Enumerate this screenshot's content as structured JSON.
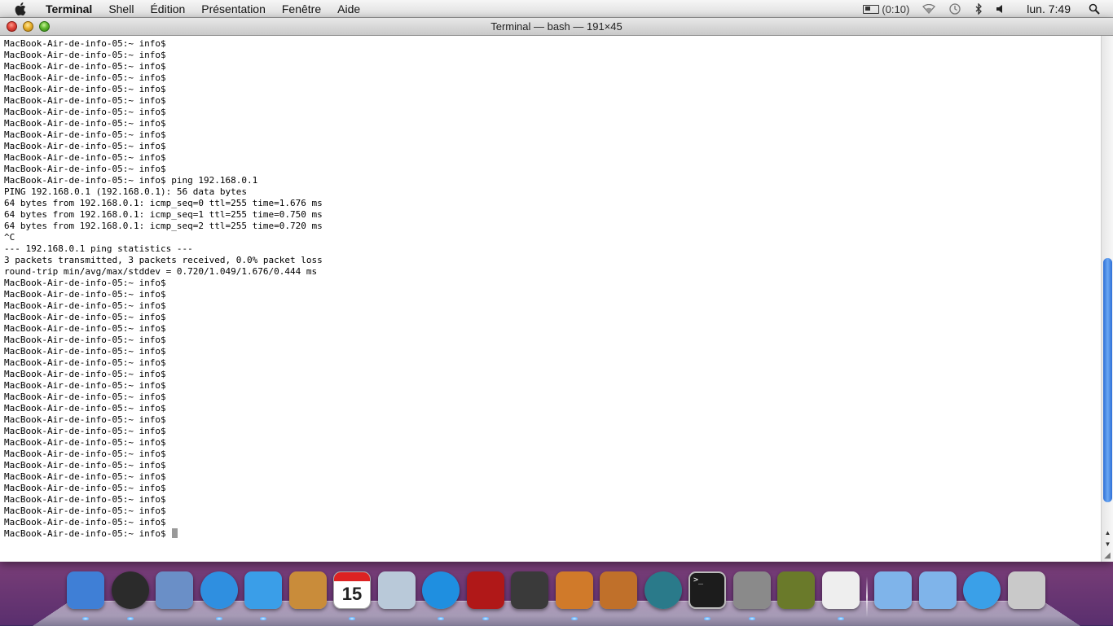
{
  "menubar": {
    "app_name": "Terminal",
    "items": [
      "Shell",
      "Édition",
      "Présentation",
      "Fenêtre",
      "Aide"
    ],
    "status": {
      "battery": "(0:10)",
      "clock": "lun. 7:49"
    }
  },
  "window": {
    "title": "Terminal — bash — 191×45"
  },
  "terminal": {
    "lines": [
      "MacBook-Air-de-info-05:~ info$",
      "MacBook-Air-de-info-05:~ info$",
      "MacBook-Air-de-info-05:~ info$",
      "MacBook-Air-de-info-05:~ info$",
      "MacBook-Air-de-info-05:~ info$",
      "MacBook-Air-de-info-05:~ info$",
      "MacBook-Air-de-info-05:~ info$",
      "MacBook-Air-de-info-05:~ info$",
      "MacBook-Air-de-info-05:~ info$",
      "MacBook-Air-de-info-05:~ info$",
      "MacBook-Air-de-info-05:~ info$",
      "MacBook-Air-de-info-05:~ info$",
      "MacBook-Air-de-info-05:~ info$ ping 192.168.0.1",
      "PING 192.168.0.1 (192.168.0.1): 56 data bytes",
      "64 bytes from 192.168.0.1: icmp_seq=0 ttl=255 time=1.676 ms",
      "64 bytes from 192.168.0.1: icmp_seq=1 ttl=255 time=0.750 ms",
      "64 bytes from 192.168.0.1: icmp_seq=2 ttl=255 time=0.720 ms",
      "^C",
      "--- 192.168.0.1 ping statistics ---",
      "3 packets transmitted, 3 packets received, 0.0% packet loss",
      "round-trip min/avg/max/stddev = 0.720/1.049/1.676/0.444 ms",
      "MacBook-Air-de-info-05:~ info$",
      "MacBook-Air-de-info-05:~ info$",
      "MacBook-Air-de-info-05:~ info$",
      "MacBook-Air-de-info-05:~ info$",
      "MacBook-Air-de-info-05:~ info$",
      "MacBook-Air-de-info-05:~ info$",
      "MacBook-Air-de-info-05:~ info$",
      "MacBook-Air-de-info-05:~ info$",
      "MacBook-Air-de-info-05:~ info$",
      "MacBook-Air-de-info-05:~ info$",
      "MacBook-Air-de-info-05:~ info$",
      "MacBook-Air-de-info-05:~ info$",
      "MacBook-Air-de-info-05:~ info$",
      "MacBook-Air-de-info-05:~ info$",
      "MacBook-Air-de-info-05:~ info$",
      "MacBook-Air-de-info-05:~ info$",
      "MacBook-Air-de-info-05:~ info$",
      "MacBook-Air-de-info-05:~ info$",
      "MacBook-Air-de-info-05:~ info$",
      "MacBook-Air-de-info-05:~ info$",
      "MacBook-Air-de-info-05:~ info$",
      "MacBook-Air-de-info-05:~ info$",
      "MacBook-Air-de-info-05:~ info$"
    ]
  },
  "scrollbar": {
    "thumb_start_fraction": 0.44,
    "thumb_size_fraction": 0.51
  },
  "dock": {
    "items": [
      {
        "icon": "finder-icon",
        "color": "#3f7fd6"
      },
      {
        "icon": "dashboard-icon",
        "color": "#2b2b2b"
      },
      {
        "icon": "mail-stamp-icon",
        "color": "#6a8fc7"
      },
      {
        "icon": "safari-icon",
        "color": "#2f8fe0"
      },
      {
        "icon": "facetime-icon",
        "color": "#3a9ee8"
      },
      {
        "icon": "address-book-icon",
        "color": "#c98c3a"
      },
      {
        "icon": "ical-icon",
        "color": "#ffffff",
        "text": "15"
      },
      {
        "icon": "preview-icon",
        "color": "#b9c9d9"
      },
      {
        "icon": "itunes-icon",
        "color": "#1f8fe0"
      },
      {
        "icon": "photo-booth-icon",
        "color": "#b01818"
      },
      {
        "icon": "imovie-icon",
        "color": "#3a3a3a"
      },
      {
        "icon": "iphoto-icon",
        "color": "#d07a2a"
      },
      {
        "icon": "garageband-icon",
        "color": "#c0702a"
      },
      {
        "icon": "time-machine-icon",
        "color": "#2a7a8a"
      },
      {
        "icon": "terminal-icon",
        "color": "#1c1c1c"
      },
      {
        "icon": "system-preferences-icon",
        "color": "#8a8a8a"
      },
      {
        "icon": "utility-cable-icon",
        "color": "#6a7a2a"
      },
      {
        "icon": "textedit-icon",
        "color": "#eeeeee"
      },
      {
        "icon": "applications-folder-icon",
        "color": "#7fb4ea"
      },
      {
        "icon": "documents-folder-icon",
        "color": "#7fb4ea"
      },
      {
        "icon": "downloads-icon",
        "color": "#3aa0e8"
      },
      {
        "icon": "trash-icon",
        "color": "#c9c9c9"
      }
    ]
  }
}
